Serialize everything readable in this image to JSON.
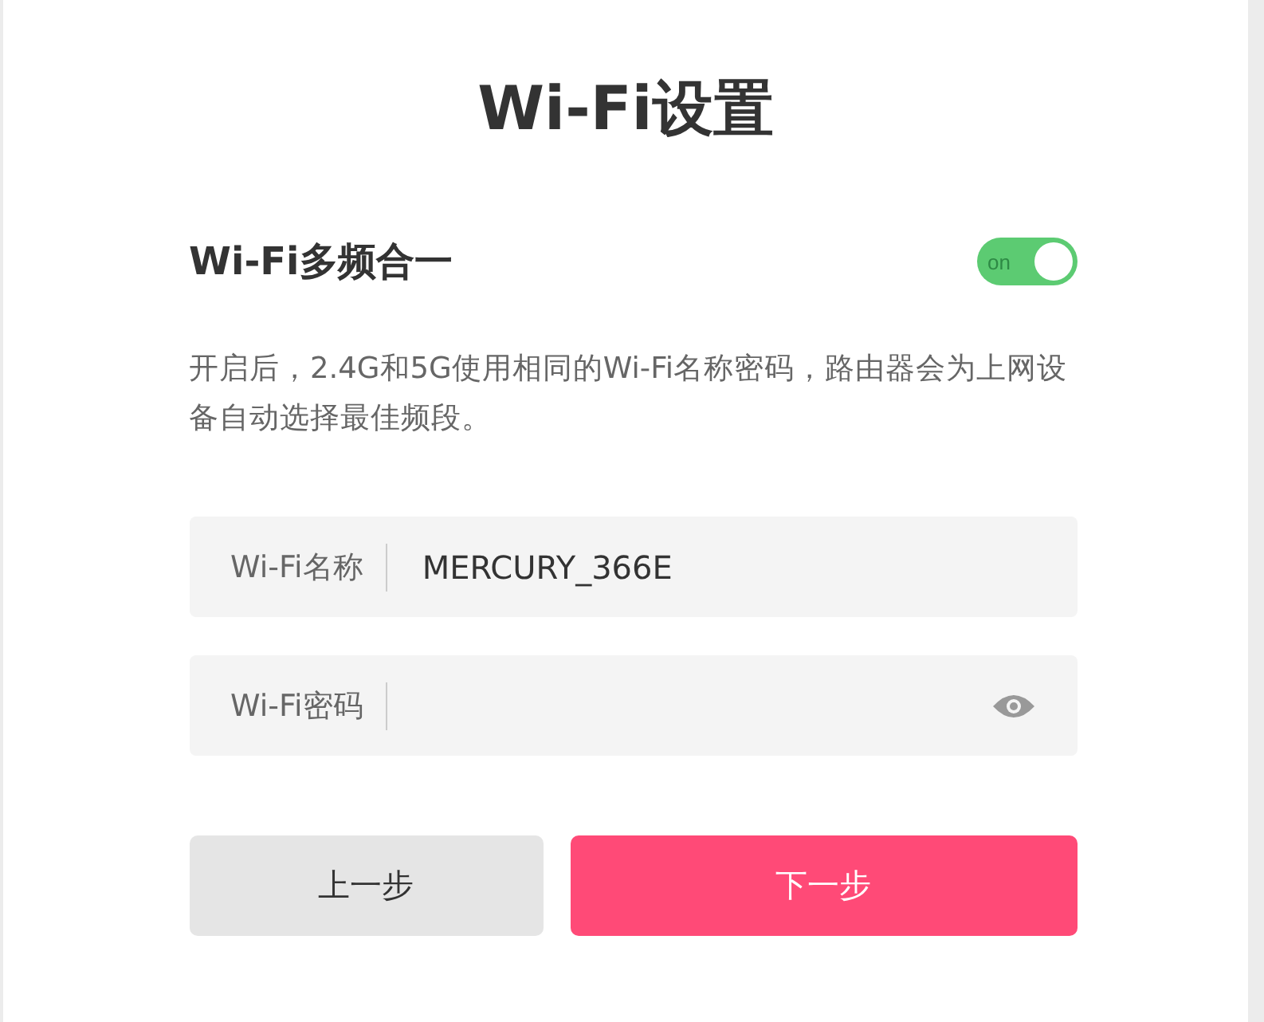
{
  "title": "Wi-Fi设置",
  "merge": {
    "label": "Wi-Fi多频合一",
    "toggle": {
      "on": true,
      "text": "on"
    },
    "description": "开启后，2.4G和5G使用相同的Wi-Fi名称密码，路由器会为上网设备自动选择最佳频段。"
  },
  "fields": [
    {
      "label": "Wi-Fi名称",
      "value": "MERCURY_366E",
      "kind": "text"
    },
    {
      "label": "Wi-Fi密码",
      "kind": "password"
    }
  ],
  "buttons": [
    {
      "label": "上一步",
      "kind": "secondary"
    },
    {
      "label": "下一步",
      "kind": "primary"
    }
  ]
}
